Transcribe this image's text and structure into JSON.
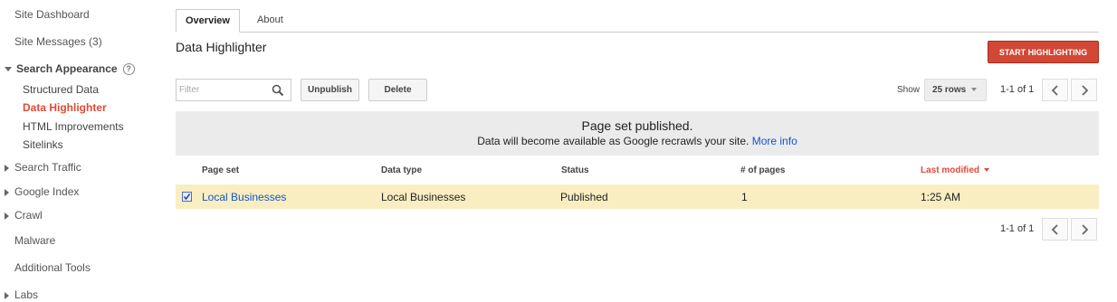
{
  "sidebar": {
    "dashboard": "Site Dashboard",
    "messages": "Site Messages (3)",
    "search_appearance": "Search Appearance",
    "sub_items": [
      "Structured Data",
      "Data Highlighter",
      "HTML Improvements",
      "Sitelinks"
    ],
    "search_traffic": "Search Traffic",
    "google_index": "Google Index",
    "crawl": "Crawl",
    "malware": "Malware",
    "additional_tools": "Additional Tools",
    "labs": "Labs"
  },
  "tabs": [
    {
      "label": "Overview",
      "active": true
    },
    {
      "label": "About",
      "active": false
    }
  ],
  "page_title": "Data Highlighter",
  "toolbar": {
    "start_button": "START HIGHLIGHTING",
    "filter_placeholder": "Filter",
    "unpublish": "Unpublish",
    "delete": "Delete",
    "show_label": "Show",
    "rows_value": "25 rows"
  },
  "pager": {
    "text": "1-1 of 1",
    "prev_icon": "chevron-left-icon",
    "next_icon": "chevron-right-icon"
  },
  "notice": {
    "title": "Page set published.",
    "body": "Data will become available as Google recrawls your site.",
    "link": "More info"
  },
  "table": {
    "columns": [
      "Page set",
      "Data type",
      "Status",
      "# of pages",
      "Last modified"
    ],
    "rows": [
      {
        "checked": true,
        "page_set": "Local Businesses",
        "data_type": "Local Businesses",
        "status": "Published",
        "pages": "1",
        "last_modified": "1:25 AM"
      }
    ]
  },
  "colors": {
    "accent_red": "#d14836",
    "link_blue": "#1155cc",
    "selected_row": "#f9eec1",
    "notice_bg": "#ebebeb"
  }
}
